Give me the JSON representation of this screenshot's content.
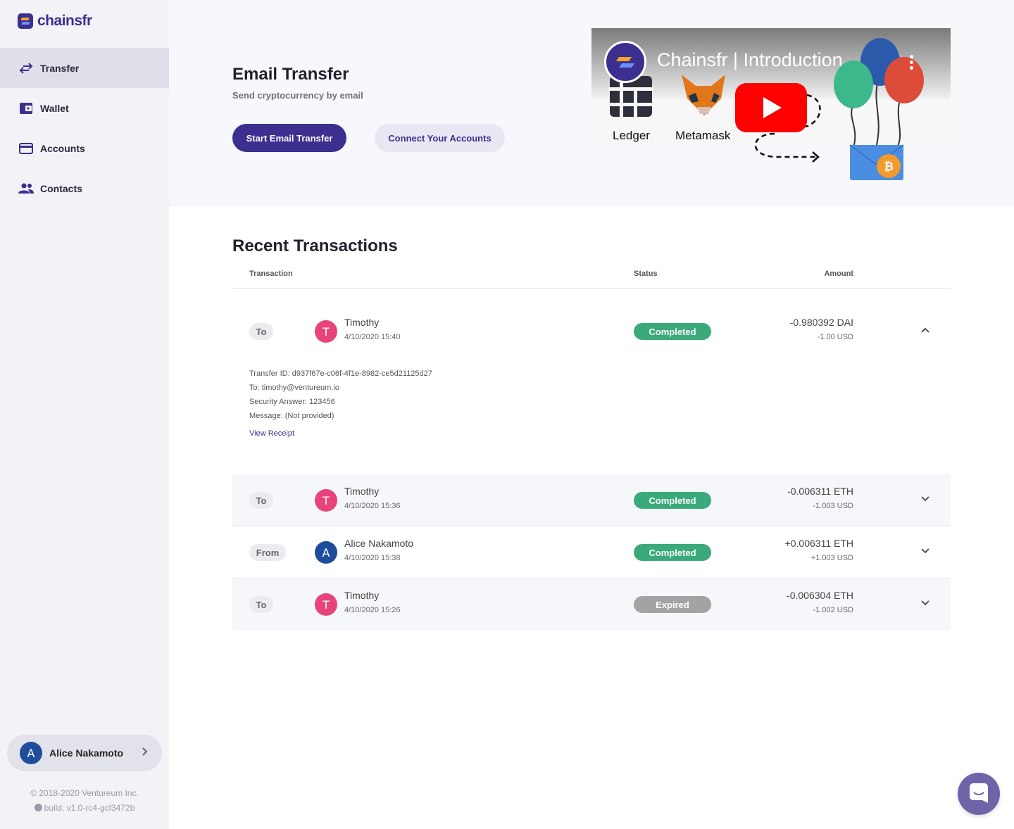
{
  "app": {
    "logo_text": "chainsfr"
  },
  "sidebar": {
    "items": [
      {
        "label": "Transfer",
        "icon": "transfer-icon",
        "active": true
      },
      {
        "label": "Wallet",
        "icon": "wallet-icon",
        "active": false
      },
      {
        "label": "Accounts",
        "icon": "card-icon",
        "active": false
      },
      {
        "label": "Contacts",
        "icon": "people-icon",
        "active": false
      }
    ],
    "user": {
      "initial": "A",
      "name": "Alice Nakamoto"
    },
    "footer": {
      "copyright": "© 2018-2020  Ventureum Inc.",
      "build": "build: v1.0-rc4-gcf3472b"
    }
  },
  "hero": {
    "title": "Email Transfer",
    "subtitle": "Send cryptocurrency by email",
    "primary_button": "Start Email Transfer",
    "secondary_button": "Connect Your Accounts",
    "video": {
      "title": "Chainsfr | Introduction",
      "ledger_label": "Ledger",
      "metamask_label": "Metamask"
    }
  },
  "transactions": {
    "title": "Recent Transactions",
    "columns": {
      "transaction": "Transaction",
      "status": "Status",
      "amount": "Amount"
    },
    "rows": [
      {
        "direction": "To",
        "initial": "T",
        "name": "Timothy",
        "date": "4/10/2020 15:40",
        "status": "Completed",
        "amount": "-0.980392 DAI",
        "usd": "-1.00 USD",
        "expanded": true
      },
      {
        "direction": "To",
        "initial": "T",
        "name": "Timothy",
        "date": "4/10/2020 15:36",
        "status": "Completed",
        "amount": "-0.006311 ETH",
        "usd": "-1.003 USD",
        "expanded": false
      },
      {
        "direction": "From",
        "initial": "A",
        "name": "Alice Nakamoto",
        "date": "4/10/2020 15:38",
        "status": "Completed",
        "amount": "+0.006311 ETH",
        "usd": "+1.003 USD",
        "expanded": false
      },
      {
        "direction": "To",
        "initial": "T",
        "name": "Timothy",
        "date": "4/10/2020 15:26",
        "status": "Expired",
        "amount": "-0.006304 ETH",
        "usd": "-1.002 USD",
        "expanded": false
      }
    ],
    "details": {
      "transfer_id": "Transfer ID: d937f67e-c06f-4f1e-8982-ce5d21125d27",
      "to": "To: timothy@ventureum.io",
      "security_answer": "Security Answer: 123456",
      "message": "Message: (Not provided)",
      "view_receipt": "View Receipt"
    }
  },
  "colors": {
    "brand": "#3b2f8f",
    "completed": "#3aaa7a",
    "expired": "#a3a3a3",
    "avatar_t": "#e8437a",
    "avatar_a": "#1f4d9b"
  }
}
